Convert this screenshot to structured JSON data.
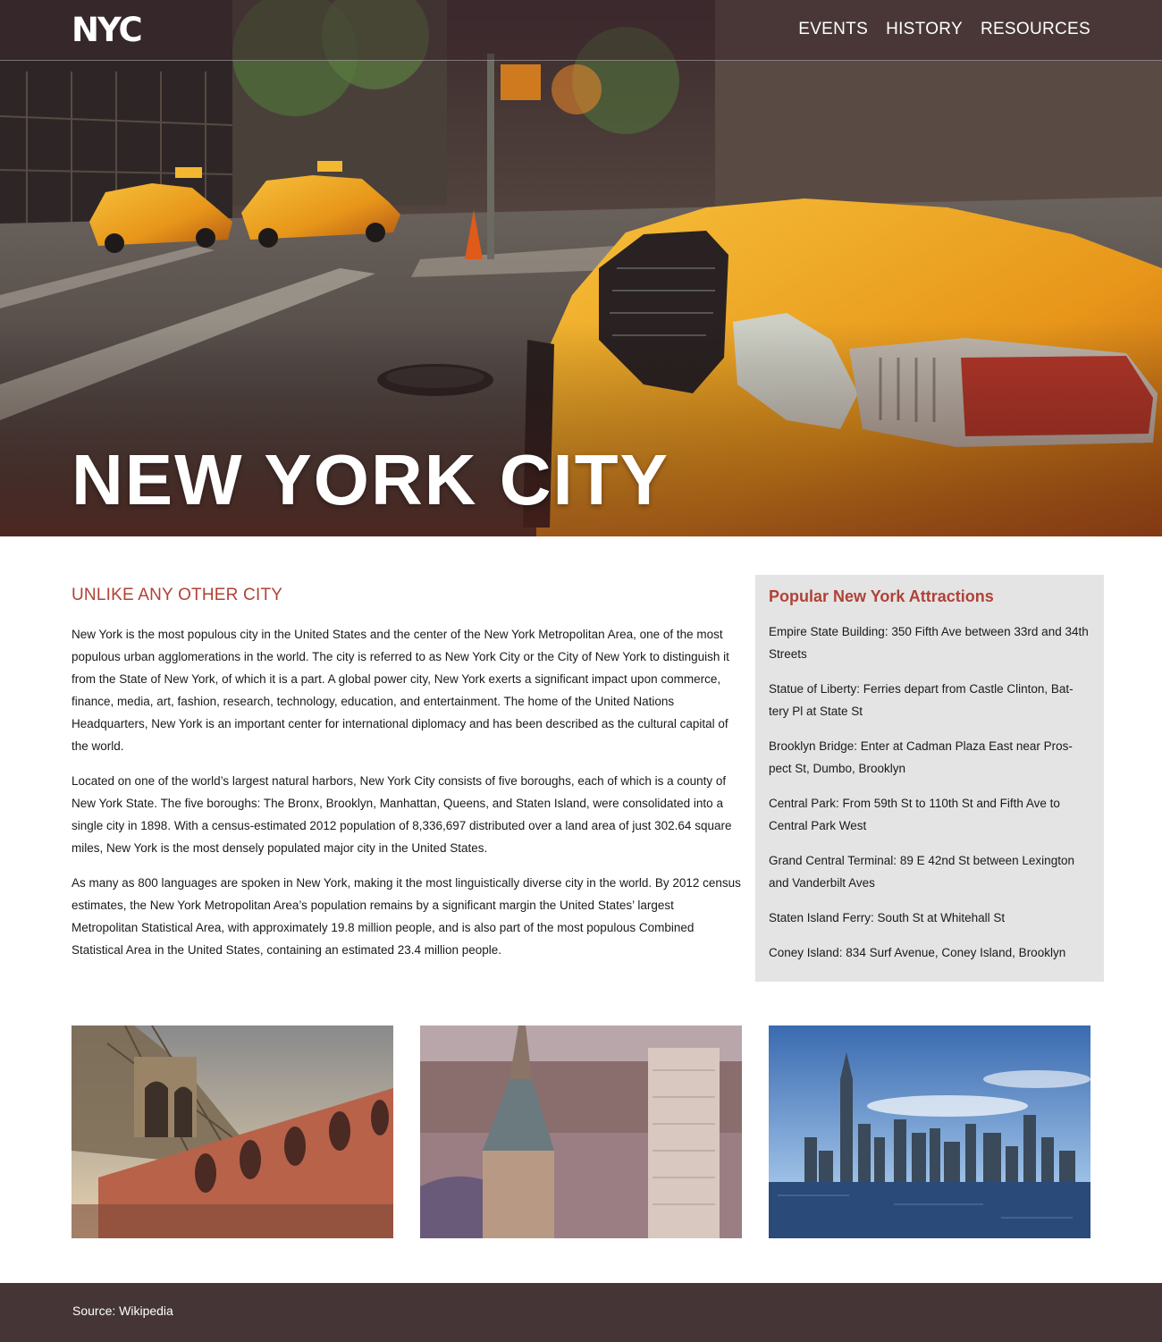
{
  "header": {
    "logo_text": "NYC",
    "nav": [
      {
        "label": "EVENTS"
      },
      {
        "label": "HISTORY"
      },
      {
        "label": "RESOURCES"
      }
    ]
  },
  "hero": {
    "title": "NEW YORK CITY"
  },
  "article": {
    "heading": "UNLIKE ANY OTHER CITY",
    "paragraphs": [
      "New York is the most populous city in the United States and the center of the New York Metropolitan Area, one of the most populous urban agglomerations in the world. The city is referred to as New York City or the City of New York to distinguish it from the State of New York, of which it is a part. A global power city, New York exerts a significant impact upon commerce, finance, media, art, fashion, research, technology, education, and entertainment. The home of the United Nations Headquarters, New York is an important center for international diplomacy and has been described as the cultural capital of the world.",
      "Located on one of the world’s largest natural harbors, New York City consists of five boroughs, each of which is a county of New York State. The five boroughs: The Bronx, Brooklyn, Manhattan, Queens, and Staten Island, were consolidated into a single city in 1898. With a census-estimated 2012 population of 8,336,697 distributed over a land area of just 302.64 square miles, New York is the most densely populated major city in the United States.",
      "As many as 800 languages are spoken in New York, making it the most linguistically diverse city in the world. By 2012 census estimates, the New York Metropolitan Area’s population remains by a significant margin the United States’ largest Metropolitan Statistical Area, with approximately 19.8 million people, and is also part of the most populous Combined Statistical Area in the United States, containing an estimated 23.4 million people."
    ]
  },
  "sidebar": {
    "heading": "Popular New York Attractions",
    "items": [
      "Empire State Building: 350 Fifth Ave between 33rd and 34th Streets",
      "Statue of Liberty: Ferries depart from Castle Clinton, Bat-tery Pl at State St",
      "Brooklyn Bridge: Enter at Cadman Plaza East near Pros-pect St, Dumbo, Brooklyn",
      "Central Park: From 59th St to 110th St and Fifth Ave to Central Park West",
      "Grand Central Terminal: 89 E 42nd St between Lexington and Vanderbilt Aves",
      "Staten Island Ferry: South St at Whitehall St",
      "Coney Island: 834 Surf Avenue, Coney Island, Brooklyn"
    ]
  },
  "footer": {
    "source": "Source: Wikipedia"
  },
  "colors": {
    "accent": "#b04236",
    "footer_bg": "#453537",
    "sidebar_bg": "#e4e4e4",
    "taxi_yellow": "#f0a820"
  }
}
